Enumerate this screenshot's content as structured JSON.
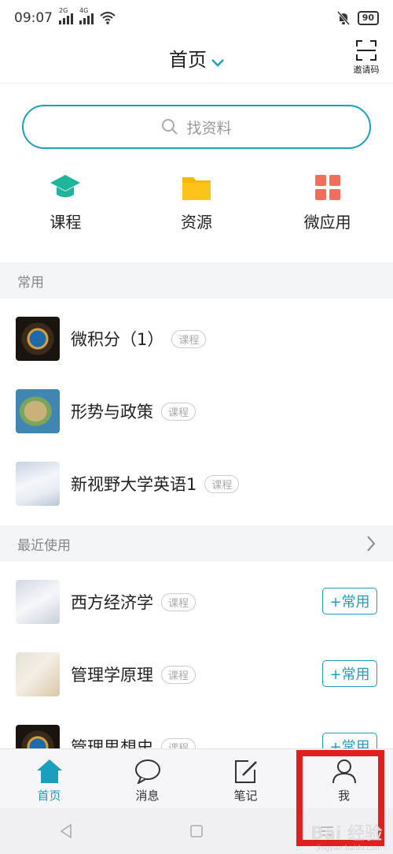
{
  "status": {
    "time": "09:07",
    "sim1": "2G",
    "sim2": "4G",
    "battery": "90"
  },
  "header": {
    "title": "首页",
    "invite_label": "邀请码"
  },
  "search": {
    "placeholder": "找资料"
  },
  "quick": [
    {
      "label": "课程",
      "icon": "mortarboard-icon",
      "color": "#1fb59a"
    },
    {
      "label": "资源",
      "icon": "folder-icon",
      "color": "#f5b800"
    },
    {
      "label": "微应用",
      "icon": "grid-icon",
      "color": "#f26d5b"
    }
  ],
  "frequent": {
    "heading": "常用",
    "items": [
      {
        "title": "微积分（1）",
        "badge": "课程"
      },
      {
        "title": "形势与政策",
        "badge": "课程"
      },
      {
        "title": "新视野大学英语1",
        "badge": "课程"
      }
    ]
  },
  "recent": {
    "heading": "最近使用",
    "add_label": "+常用",
    "items": [
      {
        "title": "西方经济学",
        "badge": "课程"
      },
      {
        "title": "管理学原理",
        "badge": "课程"
      },
      {
        "title": "管理思想史",
        "badge": "课程"
      }
    ]
  },
  "tabs": [
    {
      "label": "首页",
      "icon": "home-icon",
      "active": true
    },
    {
      "label": "消息",
      "icon": "chat-bubble-icon",
      "active": false
    },
    {
      "label": "笔记",
      "icon": "note-edit-icon",
      "active": false
    },
    {
      "label": "我",
      "icon": "person-icon",
      "active": false
    }
  ],
  "watermark": {
    "text": "Bai 经验",
    "sub": "jingyan.baidu.com"
  },
  "colors": {
    "accent": "#1a9fbf",
    "highlight": "#e02020"
  }
}
